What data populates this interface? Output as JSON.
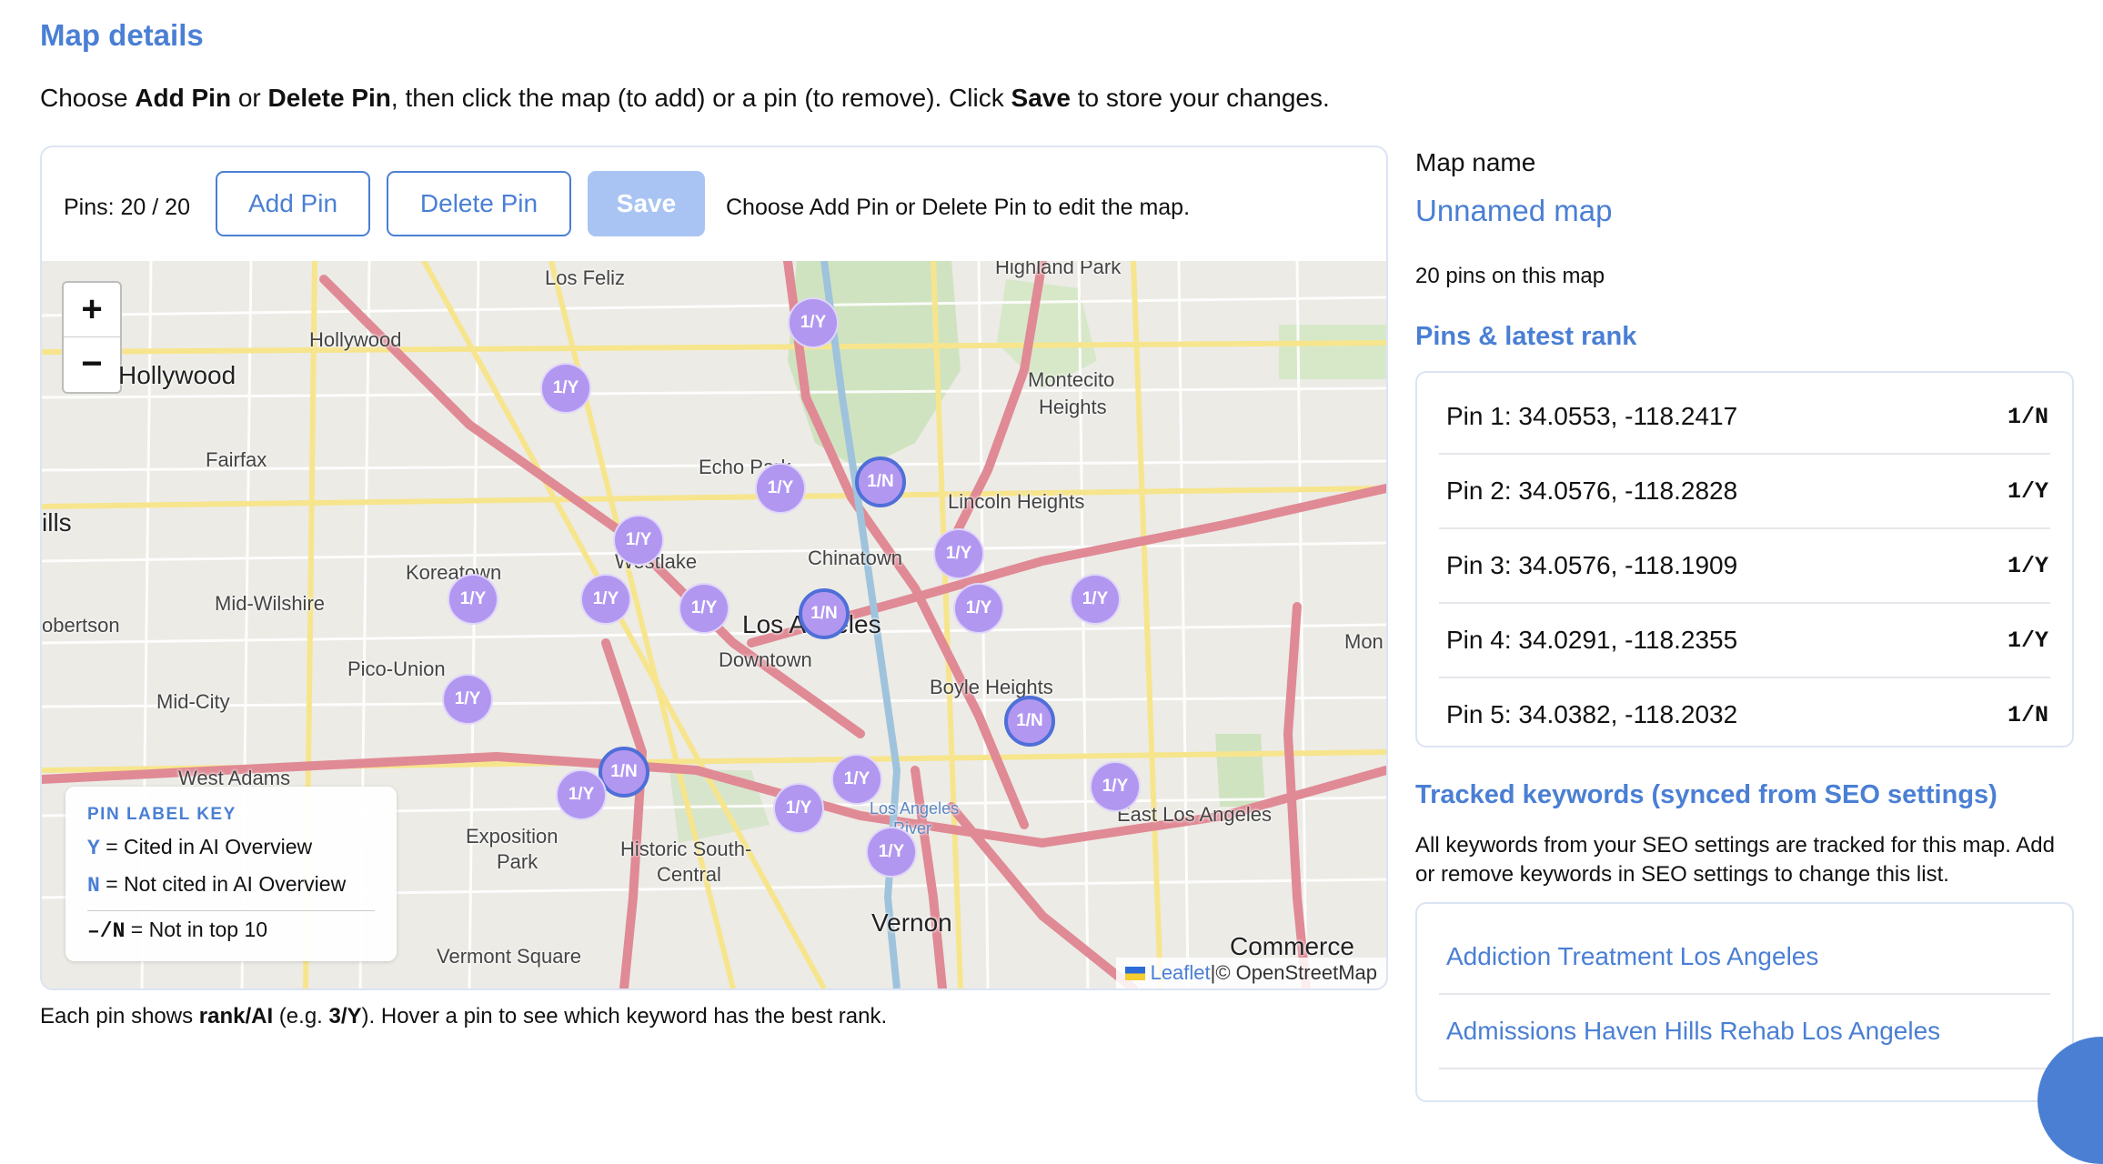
{
  "page": {
    "title": "Map details",
    "intro": {
      "t1": "Choose ",
      "b1": "Add Pin",
      "t2": " or ",
      "b2": "Delete Pin",
      "t3": ", then click the map (to add) or a pin (to remove). Click ",
      "b3": "Save",
      "t4": " to store your changes."
    }
  },
  "toolbar": {
    "pins_count": "Pins: 20 / 20",
    "add_label": "Add Pin",
    "delete_label": "Delete Pin",
    "save_label": "Save",
    "hint": "Choose Add Pin or Delete Pin to edit the map."
  },
  "map": {
    "zoom_in": "+",
    "zoom_out": "−",
    "places": {
      "los_feliz": "Los Feliz",
      "highland_park": "Highland Park",
      "hollywood": "Hollywood",
      "hollywood2": "Hollywood",
      "montecito": "Montecito",
      "heights": "Heights",
      "fairfax": "Fairfax",
      "echo_park": "Echo Park",
      "lincoln_heights": "Lincoln Heights",
      "ills": "ills",
      "westlake": "Westlake",
      "chinatown": "Chinatown",
      "koreatown": "Koreatown",
      "mid_wilshire": "Mid-Wilshire",
      "los_angeles": "Los Angeles",
      "obertson": "obertson",
      "downtown": "Downtown",
      "pico_union": "Pico-Union",
      "boyle_heights": "Boyle Heights",
      "mid_city": "Mid-City",
      "mon": "Mon",
      "west_adams": "West Adams",
      "east_la": "East Los Angeles",
      "exposition": "Exposition",
      "park": "Park",
      "historic_south": "Historic South-",
      "central": "Central",
      "la_river1": "Los Angeles",
      "la_river2": "River",
      "vernon": "Vernon",
      "commerce": "Commerce",
      "vermont_square": "Vermont Square"
    },
    "pins": [
      {
        "label": "1/Y",
        "status": "Y"
      },
      {
        "label": "1/Y",
        "status": "Y"
      },
      {
        "label": "1/Y",
        "status": "Y"
      },
      {
        "label": "1/N",
        "status": "N"
      },
      {
        "label": "1/Y",
        "status": "Y"
      },
      {
        "label": "1/Y",
        "status": "Y"
      },
      {
        "label": "1/Y",
        "status": "Y"
      },
      {
        "label": "1/Y",
        "status": "Y"
      },
      {
        "label": "1/Y",
        "status": "Y"
      },
      {
        "label": "1/N",
        "status": "N"
      },
      {
        "label": "1/Y",
        "status": "Y"
      },
      {
        "label": "1/Y",
        "status": "Y"
      },
      {
        "label": "1/Y",
        "status": "Y"
      },
      {
        "label": "1/N",
        "status": "N"
      },
      {
        "label": "1/N",
        "status": "N"
      },
      {
        "label": "1/Y",
        "status": "Y"
      },
      {
        "label": "1/Y",
        "status": "Y"
      },
      {
        "label": "1/Y",
        "status": "Y"
      },
      {
        "label": "1/Y",
        "status": "Y"
      },
      {
        "label": "1/Y",
        "status": "Y"
      }
    ],
    "legend": {
      "title": "PIN LABEL KEY",
      "y_key": "Y",
      "y_text": " = Cited in AI Overview",
      "n_key": "N",
      "n_text": " = Not cited in AI Overview",
      "dash_key": "–/N",
      "dash_text": " = Not in top 10"
    },
    "attribution": {
      "leaflet": "Leaflet",
      "sep": " | ",
      "osm": "© OpenStreetMap"
    }
  },
  "footnote": {
    "t1": "Each pin shows ",
    "b1": "rank/AI",
    "t2": " (e.g. ",
    "b2": "3/Y",
    "t3": "). Hover a pin to see which keyword has the best rank."
  },
  "sidebar": {
    "map_name_label": "Map name",
    "map_name": "Unnamed map",
    "pin_count_text": "20 pins on this map",
    "pins_heading": "Pins & latest rank",
    "pins": [
      {
        "text": "Pin 1: 34.0553, -118.2417",
        "rank": "1/N"
      },
      {
        "text": "Pin 2: 34.0576, -118.2828",
        "rank": "1/Y"
      },
      {
        "text": "Pin 3: 34.0576, -118.1909",
        "rank": "1/Y"
      },
      {
        "text": "Pin 4: 34.0291, -118.2355",
        "rank": "1/Y"
      },
      {
        "text": "Pin 5: 34.0382, -118.2032",
        "rank": "1/N"
      }
    ],
    "keywords_heading": "Tracked keywords (synced from SEO settings)",
    "keywords_desc": "All keywords from your SEO settings are tracked for this map. Add or remove keywords in SEO settings to change this list.",
    "keywords": [
      "Addiction Treatment Los Angeles",
      "Admissions Haven Hills Rehab Los Angeles"
    ]
  },
  "colors": {
    "accent": "#4a7fd4",
    "pin_fill": "#b197f0",
    "pin_n_border": "#4f6fd8",
    "save_disabled": "#a9c4f3"
  }
}
